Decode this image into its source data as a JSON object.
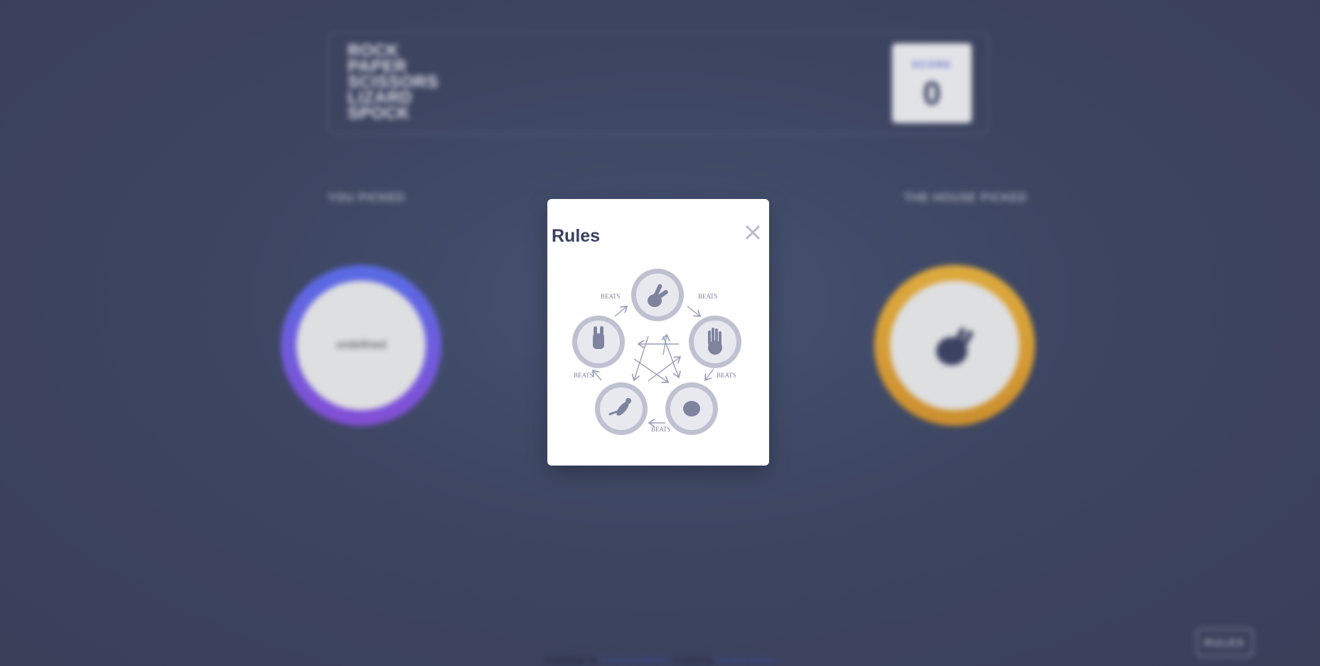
{
  "header": {
    "title_words": [
      "ROCK",
      "PAPER",
      "SCISSORS",
      "LIZARD",
      "SPOCK"
    ],
    "score_label": "SCORE",
    "score_value": "0"
  },
  "game": {
    "you_picked_label": "YOU PICKED",
    "house_picked_label": "THE HOUSE PICKED",
    "user_token_broken_image_text": "undefined",
    "house_token_icon": "spock-hand-icon",
    "colors": {
      "user_ring": "#5b6ee8",
      "house_ring": "#e7a734"
    }
  },
  "footer": {
    "challenge_prefix": "Challenge by",
    "challenge_link": "Frontend Mentor",
    "coded_prefix": ". Coded by",
    "coder_name": "Samiha Bodiur"
  },
  "rules_button": {
    "label": "RULES"
  },
  "modal": {
    "title": "Rules",
    "close_icon": "close-icon",
    "beats_label": "BEATS",
    "diagram_icons": [
      "scissors-hand-icon",
      "paper-hand-icon",
      "rock-hand-icon",
      "lizard-icon",
      "spock-hand-icon"
    ]
  }
}
